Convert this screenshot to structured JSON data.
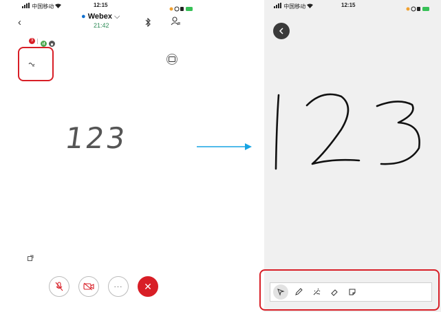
{
  "left_phone": {
    "status": {
      "carrier": "中国移动",
      "time": "12:15"
    },
    "header": {
      "app_name": "Webex",
      "timer": "21:42"
    },
    "indicators": {
      "record_badge": "3"
    },
    "whiteboard_text": "123"
  },
  "right_phone": {
    "status": {
      "carrier": "中国移动",
      "time": "12:15"
    },
    "canvas_text": "123"
  },
  "colors": {
    "accent_red": "#d81e26",
    "webex_blue": "#1170cf",
    "arrow": "#17a4e3",
    "timer_green": "#2e8b57"
  },
  "controls": [
    "mic-muted-icon",
    "camera-off-icon",
    "more-icon",
    "end-call-icon"
  ],
  "tools": [
    "select-icon",
    "pen-icon",
    "magic-pen-icon",
    "eraser-icon",
    "sticky-note-icon"
  ]
}
